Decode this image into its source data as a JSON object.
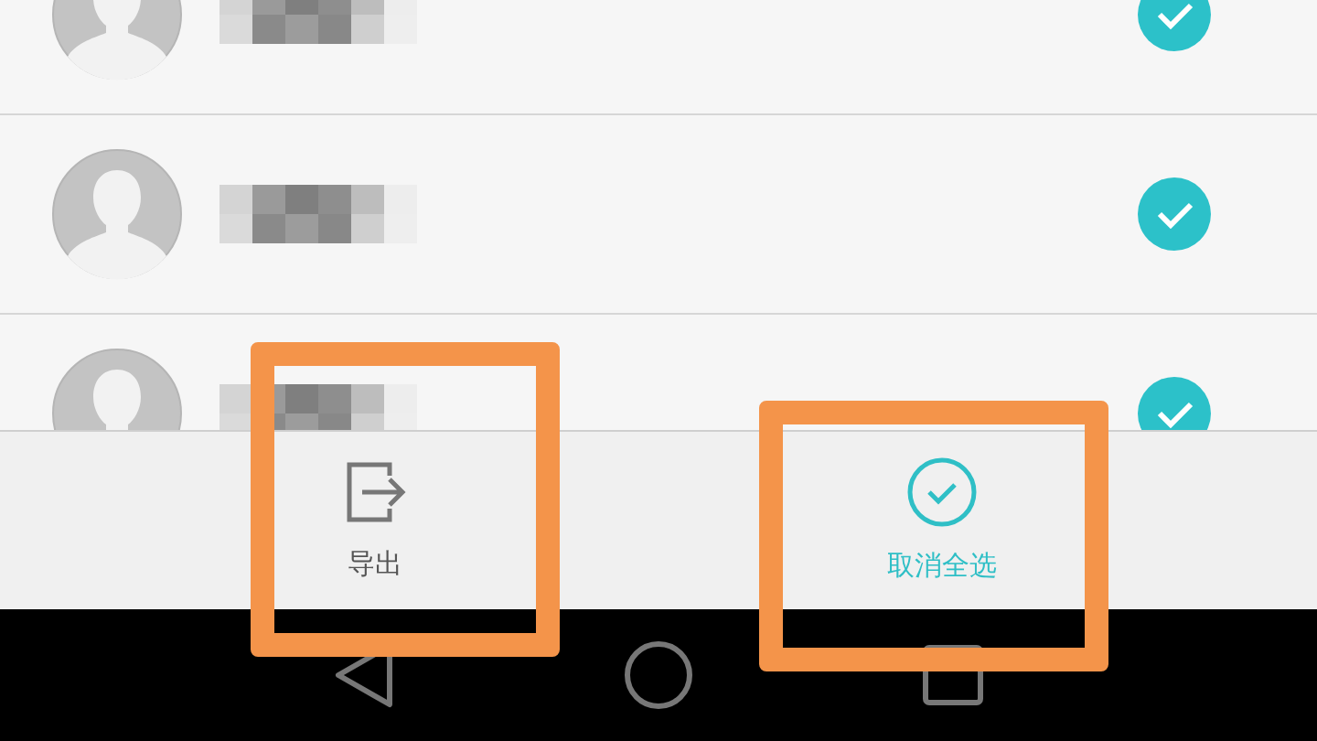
{
  "contacts": [
    {
      "checked": true
    },
    {
      "checked": true
    },
    {
      "checked": true
    }
  ],
  "actions": [
    {
      "kind": "export",
      "label": "导出",
      "active": false,
      "highlighted": true
    },
    {
      "kind": "select",
      "label": "取消全选",
      "active": true,
      "highlighted": true
    }
  ],
  "nav_bar": {
    "buttons": [
      {
        "kind": "back"
      },
      {
        "kind": "home"
      },
      {
        "kind": "recents"
      }
    ]
  }
}
